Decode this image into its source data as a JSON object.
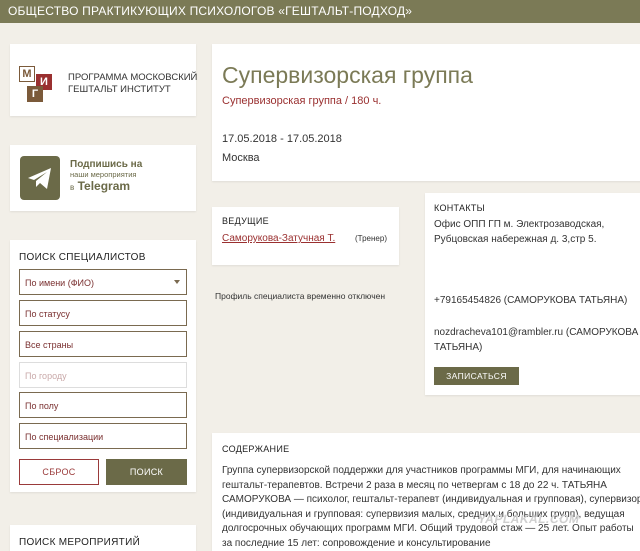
{
  "header": {
    "title": "ОБЩЕСТВО ПРАКТИКУЮЩИХ ПСИХОЛОГОВ «ГЕШТАЛЬТ-ПОДХОД»"
  },
  "sidebar": {
    "mgi_logo": {
      "letters": [
        "М",
        "И",
        "Г"
      ],
      "text": "ПРОГРАММА МОСКОВСКИЙ ГЕШТАЛЬТ ИНСТИТУТ"
    },
    "telegram": {
      "line1": "Подпишись на",
      "line2": "наши мероприятия",
      "prefix": "в",
      "brand": "Telegram"
    },
    "specialist_search": {
      "title": "ПОИСК СПЕЦИАЛИСТОВ",
      "name_select": "По имени (ФИО)",
      "status": "По статусу",
      "country": "Все страны",
      "city": "По городу",
      "gender": "По полу",
      "specialization": "По специализации",
      "reset_label": "СБРОС",
      "search_label": "ПОИСК"
    },
    "events_search": {
      "title": "ПОИСК МЕРОПРИЯТИЙ"
    }
  },
  "event": {
    "title": "Супервизорская группа",
    "subtitle": "Супервизорская группа / 180 ч.",
    "dates": "17.05.2018 - 17.05.2018",
    "city": "Москва"
  },
  "leaders": {
    "title": "ВЕДУЩИЕ",
    "name": "Саморукова-Затучная Т.",
    "role": "(Тренер)",
    "profile_disabled": "Профиль специалиста временно отключен"
  },
  "contacts": {
    "title": "КОНТАКТЫ",
    "address": "Офис ОПП ГП м. Электрозаводская, Рубцовская набережная д. 3,стр 5.",
    "phone": "+79165454826 (САМОРУКОВА ТАТЬЯНА)",
    "email": "nozdracheva101@rambler.ru (САМОРУКОВА ТАТЬЯНА)",
    "signup_label": "ЗАПИСАТЬСЯ"
  },
  "content": {
    "title": "СОДЕРЖАНИЕ",
    "text": "Группа супервизорской поддержки для участников программы МГИ, для начинающих гештальт-терапевтов. Встречи 2 раза в месяц по четвергам с 18 до 22 ч. ТАТЬЯНА САМОРУКОВА — психолог, гештальт-терапевт (индивидуальная и групповая), супервизор (индивидуальная и групповая: супервизия малых, средних и больших групп), ведущая долгосрочных обучающих программ МГИ. Общий трудовой стаж — 25 лет. Опыт работы за последние 15 лет: сопровождение и консультирование"
  },
  "watermark": "YAPLAKAL.COM",
  "colors": {
    "brand": "#7b7a56",
    "accent": "#9a3030",
    "background": "#f2efe8"
  }
}
